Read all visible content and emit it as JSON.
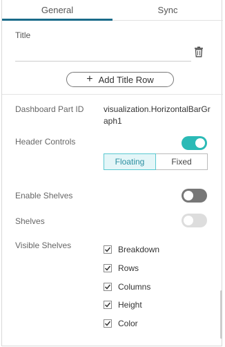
{
  "tabs": [
    {
      "label": "General",
      "active": true
    },
    {
      "label": "Sync",
      "active": false
    }
  ],
  "title_section": {
    "label": "Title",
    "input_value": "",
    "add_row_label": "Add Title Row"
  },
  "dashboard_part_id": {
    "label": "Dashboard Part ID",
    "value": "visualization.HorizontalBarGraph1"
  },
  "header_controls": {
    "label": "Header Controls",
    "toggle_on": true,
    "options": [
      "Floating",
      "Fixed"
    ],
    "selected": "Floating"
  },
  "enable_shelves": {
    "label": "Enable Shelves",
    "toggle_on": false
  },
  "shelves": {
    "label": "Shelves",
    "toggle_on": false,
    "disabled": true
  },
  "visible_shelves": {
    "label": "Visible Shelves",
    "items": [
      {
        "label": "Breakdown",
        "checked": true
      },
      {
        "label": "Rows",
        "checked": true
      },
      {
        "label": "Columns",
        "checked": true
      },
      {
        "label": "Height",
        "checked": true
      },
      {
        "label": "Color",
        "checked": true
      }
    ]
  },
  "colors": {
    "accent": "#2bbab6",
    "tab_underline": "#1a6b8a"
  },
  "icons": {
    "trash": "trash-icon",
    "plus": "plus-icon",
    "check": "checkmark-icon"
  }
}
